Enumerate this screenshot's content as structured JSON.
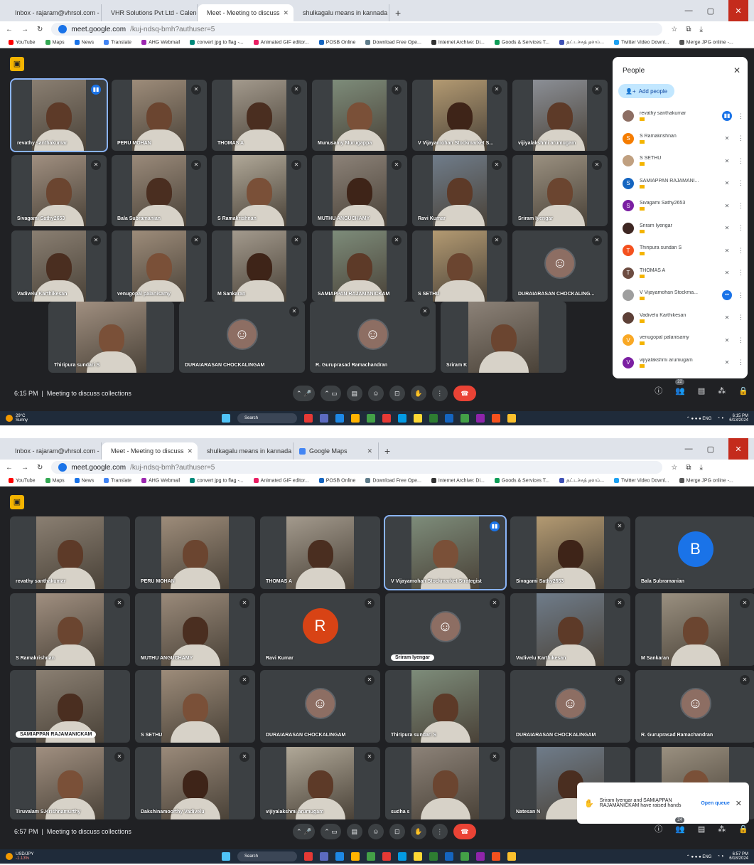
{
  "browser": {
    "tabs1": [
      {
        "label": "Inbox - rajaram@vhrsol.com - ",
        "active": false
      },
      {
        "label": "VHR Solutions Pvt Ltd - Calend",
        "active": false
      },
      {
        "label": "Meet - Meeting to discuss",
        "active": true
      },
      {
        "label": "shulkagalu means in kannada -",
        "active": false
      }
    ],
    "tabs2": [
      {
        "label": "Inbox - rajaram@vhrsol.com - ",
        "active": false
      },
      {
        "label": "Meet - Meeting to discuss",
        "active": true
      },
      {
        "label": "shulkagalu means in kannada -",
        "active": false
      },
      {
        "label": "Google Maps",
        "active": false
      }
    ],
    "url_host": "meet.google.com",
    "url_path": "/kuj-ndsq-bmh?authuser=5",
    "bookmarks": [
      "YouTube",
      "Maps",
      "News",
      "Translate",
      "AHG Webmail",
      "convert jpg to flag -...",
      "Animated GIF editor...",
      "POSB Online",
      "Download Free Ope...",
      "Internet Archive: Di...",
      "Goods & Services T...",
      "தட்டச்சுத் தளம்...",
      "Twitter Video Downl...",
      "Merge JPG online -..."
    ]
  },
  "s1": {
    "tiles": [
      {
        "name": "revathy santhakumar",
        "mic": "active",
        "photo": true
      },
      {
        "name": "PERU MOHAN",
        "mic": "muted",
        "photo": true
      },
      {
        "name": "THOMAS A",
        "mic": "muted",
        "photo": true
      },
      {
        "name": "Munusamy Murugappa",
        "mic": "muted",
        "photo": true
      },
      {
        "name": "V Vijayamohan Stockmarket S...",
        "mic": "muted",
        "photo": true
      },
      {
        "name": "vijiyalakshmi arumugam",
        "mic": "muted",
        "photo": true
      },
      {
        "name": "Sivagami Sathy2653",
        "mic": "muted",
        "photo": true
      },
      {
        "name": "Bala Subramanian",
        "mic": "muted",
        "photo": true
      },
      {
        "name": "S Ramakrishnan",
        "mic": "muted",
        "photo": true
      },
      {
        "name": "MUTHU ANGUCHAMY",
        "mic": "muted",
        "photo": true
      },
      {
        "name": "Ravi Kumar",
        "mic": "muted",
        "photo": true
      },
      {
        "name": "Sriram Iyengar",
        "mic": "muted",
        "photo": true
      },
      {
        "name": "Vadivelu Karthikesan",
        "mic": "muted",
        "photo": true
      },
      {
        "name": "venugopal palanisamy",
        "mic": "muted",
        "photo": true
      },
      {
        "name": "M Sankaran",
        "mic": "muted",
        "photo": true
      },
      {
        "name": "SAMIAPPAN RAJAMANICKAM",
        "mic": "muted",
        "photo": true
      },
      {
        "name": "S SETHU",
        "mic": "muted",
        "photo": true
      },
      {
        "name": "DURAIARASAN CHOCKALING...",
        "mic": "muted",
        "avatar": true
      },
      {
        "name": "Thiripura sundari S",
        "mic": "none",
        "photo": true
      },
      {
        "name": "DURAIARASAN CHOCKALINGAM",
        "mic": "muted",
        "avatar": true
      },
      {
        "name": "R. Guruprasad Ramachandran",
        "mic": "muted",
        "avatar": true
      },
      {
        "name": "Sriram K",
        "mic": "none",
        "photo": true
      }
    ],
    "people": {
      "title": "People",
      "add_label": "Add people",
      "rows": [
        {
          "name": "revathy santhakumar",
          "color": "#8d6e63",
          "letter": "",
          "mic": "active"
        },
        {
          "name": "S Ramakrishnan",
          "color": "#f57c00",
          "letter": "S",
          "mic": "muted"
        },
        {
          "name": "S SETHU",
          "color": "#c0a080",
          "letter": "",
          "mic": "muted"
        },
        {
          "name": "SAMIAPPAN RAJAMANI...",
          "color": "#1565c0",
          "letter": "S",
          "mic": "muted"
        },
        {
          "name": "Sivagami Sathy2653",
          "color": "#7b1fa2",
          "letter": "S",
          "mic": "muted"
        },
        {
          "name": "Sriram Iyengar",
          "color": "#3e2723",
          "letter": "",
          "mic": "muted"
        },
        {
          "name": "Thiripura sundari S",
          "color": "#f4511e",
          "letter": "T",
          "mic": "muted"
        },
        {
          "name": "THOMAS A",
          "color": "#6d4c41",
          "letter": "T",
          "mic": "muted"
        },
        {
          "name": "V Vijayamohan Stockma...",
          "color": "#9e9e9e",
          "letter": "",
          "mic": "more"
        },
        {
          "name": "Vadivelu Karthikesan",
          "color": "#5d4037",
          "letter": "",
          "mic": "muted"
        },
        {
          "name": "venugopal palanisamy",
          "color": "#f9a825",
          "letter": "V",
          "mic": "muted"
        },
        {
          "name": "vijiyalakshmi arumugam",
          "color": "#7b1fa2",
          "letter": "V",
          "mic": "muted"
        }
      ]
    },
    "time": "6:15 PM",
    "meeting": "Meeting to discuss collections",
    "participants": "22",
    "weather": {
      "temp": "29°C",
      "cond": "Sunny"
    },
    "clock": {
      "time": "6:15 PM",
      "date": "6/13/2024"
    }
  },
  "s2": {
    "tiles": [
      {
        "name": "revathy santhakumar",
        "mic": "none",
        "photo": true
      },
      {
        "name": "PERU MOHAN",
        "mic": "none",
        "photo": true
      },
      {
        "name": "THOMAS A",
        "mic": "none",
        "photo": true
      },
      {
        "name": "V Vijayamohan Stockmarket Strategist",
        "mic": "active",
        "photo": true
      },
      {
        "name": "Sivagami Sathy2653",
        "mic": "muted",
        "photo": true
      },
      {
        "name": "Bala Subramanian",
        "mic": "none",
        "letter": "B",
        "color": "#1a73e8"
      },
      {
        "name": "S Ramakrishnan",
        "mic": "muted",
        "photo": true
      },
      {
        "name": "MUTHU ANGUCHAMY",
        "mic": "muted",
        "photo": true
      },
      {
        "name": "Ravi Kumar",
        "mic": "muted",
        "letter": "R",
        "color": "#d84315"
      },
      {
        "name": "Sriram Iyengar",
        "mic": "muted",
        "avatar": true,
        "pill": true
      },
      {
        "name": "Vadivelu Karthikesan",
        "mic": "muted",
        "photo": true
      },
      {
        "name": "M Sankaran",
        "mic": "muted",
        "photo": true
      },
      {
        "name": "SAMIAPPAN RAJAMANICKAM",
        "mic": "none",
        "photo": true,
        "pill": true
      },
      {
        "name": "S SETHU",
        "mic": "muted",
        "photo": true
      },
      {
        "name": "DURAIARASAN CHOCKALINGAM",
        "mic": "muted",
        "avatar": true
      },
      {
        "name": "Thiripura sundari S",
        "mic": "none",
        "photo": true
      },
      {
        "name": "DURAIARASAN CHOCKALINGAM",
        "mic": "muted",
        "avatar": true
      },
      {
        "name": "R. Guruprasad Ramachandran",
        "mic": "muted",
        "avatar": true
      },
      {
        "name": "Tiruvalam S.Krishnamurthy",
        "mic": "muted",
        "photo": true
      },
      {
        "name": "Dakshinamoorthy Vadivelu",
        "mic": "muted",
        "photo": true
      },
      {
        "name": "vijiyalakshmi arumugam",
        "mic": "muted",
        "photo": true
      },
      {
        "name": "sudha s",
        "mic": "muted",
        "photo": true
      },
      {
        "name": "Natesan N",
        "mic": "none",
        "photo": true
      },
      {
        "name": "",
        "mic": "none",
        "photo": true
      }
    ],
    "toast": {
      "text": "Sriram Iyengar and SAMIAPPAN RAJAMANICKAM have raised hands",
      "action": "Open queue"
    },
    "time": "6:57 PM",
    "meeting": "Meeting to discuss collections",
    "participants": "24",
    "weather": {
      "temp": "USD/JPY",
      "cond": "-1.13%"
    },
    "clock": {
      "time": "6:57 PM",
      "date": "6/18/2024"
    }
  },
  "taskbar": {
    "search": "Search"
  }
}
